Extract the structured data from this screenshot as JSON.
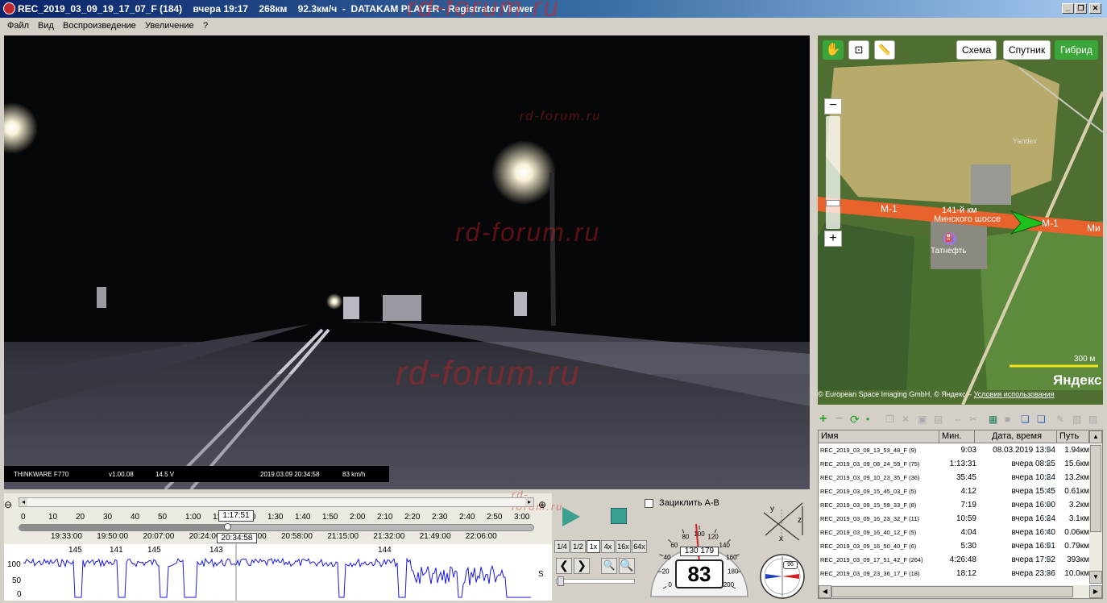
{
  "window": {
    "title": "REC_2019_03_09_19_17_07_F (184)    вчера 19:17    268км    92.3км/ч  -  DATAKAM PLAYER - Registrator Viewer",
    "watermark": "rd-forum.ru"
  },
  "menu": [
    "Файл",
    "Вид",
    "Воспроизведение",
    "Увеличение",
    "?"
  ],
  "video": {
    "watermark": "rd-forum.ru",
    "osd": {
      "device": "THINKWARE F770",
      "version": "v1.00.08",
      "voltage": "14.5 V",
      "datetime": "2019.03.09 20:34:58",
      "speed": "83 km/h"
    }
  },
  "timeline": {
    "watermark": "rd-forum.ru",
    "elapsed_ticks": [
      "0",
      "10",
      "20",
      "30",
      "40",
      "50",
      "1:00",
      "1:10",
      "1:20",
      "1:30",
      "1:40",
      "1:50",
      "2:00",
      "2:10",
      "2:20",
      "2:30",
      "2:40",
      "2:50",
      "3:00"
    ],
    "position_label": "1:17:51",
    "clock_ticks": [
      "19:33:00",
      "19:50:00",
      "20:07:00",
      "20:24:00",
      "20:41:00",
      "20:58:00",
      "21:15:00",
      "21:32:00",
      "21:49:00",
      "22:06:00"
    ],
    "clock_label": "20:34:58",
    "speed_axis": [
      "100",
      "50",
      "0"
    ],
    "speed_peaks": [
      "145",
      "141",
      "145",
      "143",
      "144"
    ],
    "s_label": "S",
    "progress_fraction": 0.405
  },
  "player": {
    "loop_label": "Зациклить А-В",
    "speed_buttons": [
      "1/4",
      "1/2",
      "1x",
      "4x",
      "16x",
      "64x"
    ],
    "active_speed": "1x"
  },
  "speedometer": {
    "speed": "83",
    "odometer": "130 179",
    "scale": [
      "0",
      "20",
      "40",
      "60",
      "80",
      "100",
      "120",
      "140",
      "160",
      "180",
      "200"
    ]
  },
  "axes_widget": {
    "x": "x",
    "y": "y",
    "z": "z"
  },
  "compass": {
    "value": "96"
  },
  "map": {
    "mode_buttons": [
      "Схема",
      "Спутник",
      "Гибрид"
    ],
    "active_mode": "Гибрид",
    "road_label_left": "М-1",
    "road_label_right": "М-1",
    "road_label_far": "Ми",
    "km_label": "141-й км",
    "road_name": "Минского шоссе",
    "poi": "Татнефть",
    "yandex_small": "Yandex",
    "scale": "300 м",
    "brand": "Яндекс",
    "copyright": "© European Space Imaging GmbH, © Яндекс –",
    "terms_link": "Условия использования"
  },
  "file_list": {
    "columns": [
      "Имя",
      "Мин.",
      "Дата, время",
      "Путь"
    ],
    "rows": [
      {
        "name": "REC_2019_03_08_13_53_48_F (9)",
        "min": "9:03",
        "date": "08.03.2019 13:54",
        "path": "1.94км"
      },
      {
        "name": "REC_2019_03_09_08_24_59_F (75)",
        "min": "1:13:31",
        "date": "вчера 08:25",
        "path": "15.6км"
      },
      {
        "name": "REC_2019_03_09_10_23_35_F (36)",
        "min": "35:45",
        "date": "вчера 10:24",
        "path": "13.2км"
      },
      {
        "name": "REC_2019_03_09_15_45_03_F (5)",
        "min": "4:12",
        "date": "вчера 15:45",
        "path": "0.61км"
      },
      {
        "name": "REC_2019_03_09_15_59_33_F (8)",
        "min": "7:19",
        "date": "вчера 16:00",
        "path": "3.2км"
      },
      {
        "name": "REC_2019_03_09_16_23_32_F (11)",
        "min": "10:59",
        "date": "вчера 16:24",
        "path": "3.1км"
      },
      {
        "name": "REC_2019_03_09_16_40_12_F (5)",
        "min": "4:04",
        "date": "вчера 16:40",
        "path": "0.06км"
      },
      {
        "name": "REC_2019_03_09_16_50_40_F (6)",
        "min": "5:30",
        "date": "вчера 16:51",
        "path": "0.79км"
      },
      {
        "name": "REC_2019_03_09_17_51_42_F (264)",
        "min": "4:26:48",
        "date": "вчера 17:52",
        "path": "393км"
      },
      {
        "name": "REC_2019_03_09_23_36_17_F (18)",
        "min": "18:12",
        "date": "вчера 23:36",
        "path": "10.0км"
      }
    ]
  },
  "colors": {
    "accent_green": "#3aa63a",
    "road": "#e8622c",
    "speed_line": "#1a1adc"
  }
}
